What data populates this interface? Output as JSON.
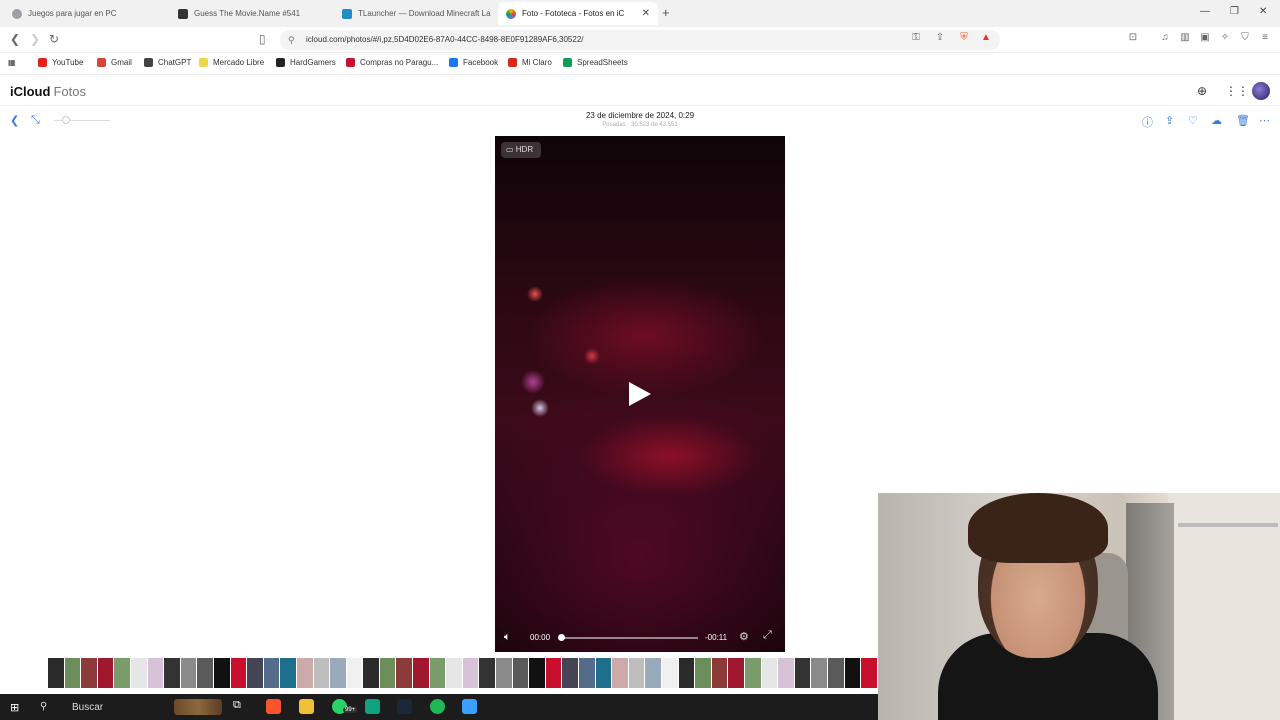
{
  "browser": {
    "tabs": [
      {
        "title": "Juegos para jugar en PC",
        "active": false
      },
      {
        "title": "Guess The Movie.Name #541",
        "active": false
      },
      {
        "title": "TLauncher — Download Minecraft La",
        "active": false
      },
      {
        "title": "Foto - Fototeca - Fotos en iC",
        "active": true
      }
    ],
    "new_tab": "+",
    "url": "icloud.com/photos/#/i,pz,5D4D02E6-87A0-44CC-8498-8E0F91289AF6,30522/",
    "bookmarks": [
      {
        "label": "YouTube",
        "color": "#e62117"
      },
      {
        "label": "Gmail",
        "color": "#d44638"
      },
      {
        "label": "ChatGPT",
        "color": "#444444"
      },
      {
        "label": "Mercado Libre",
        "color": "#e8d84a"
      },
      {
        "label": "HardGamers",
        "color": "#222222"
      },
      {
        "label": "Compras no Paragu...",
        "color": "#c8102e"
      },
      {
        "label": "Facebook",
        "color": "#1877f2"
      },
      {
        "label": "Mi Claro",
        "color": "#da291c"
      },
      {
        "label": "SpreadSheets",
        "color": "#0f9d58"
      }
    ]
  },
  "icloud": {
    "brand_main": "iCloud",
    "brand_app": "Fotos"
  },
  "photo": {
    "date": "23 de diciembre de 2024, 0:29",
    "count": "Posadas · 30.523 de 43.551",
    "hdr_label": "HDR",
    "time_current": "00:00",
    "time_remaining": "-00:11",
    "progress": 0.0
  },
  "taskbar": {
    "search_label": "Buscar",
    "badge": "99+"
  },
  "colors": {
    "accent": "#3a7bdc",
    "video_bg": "#2a0812"
  }
}
